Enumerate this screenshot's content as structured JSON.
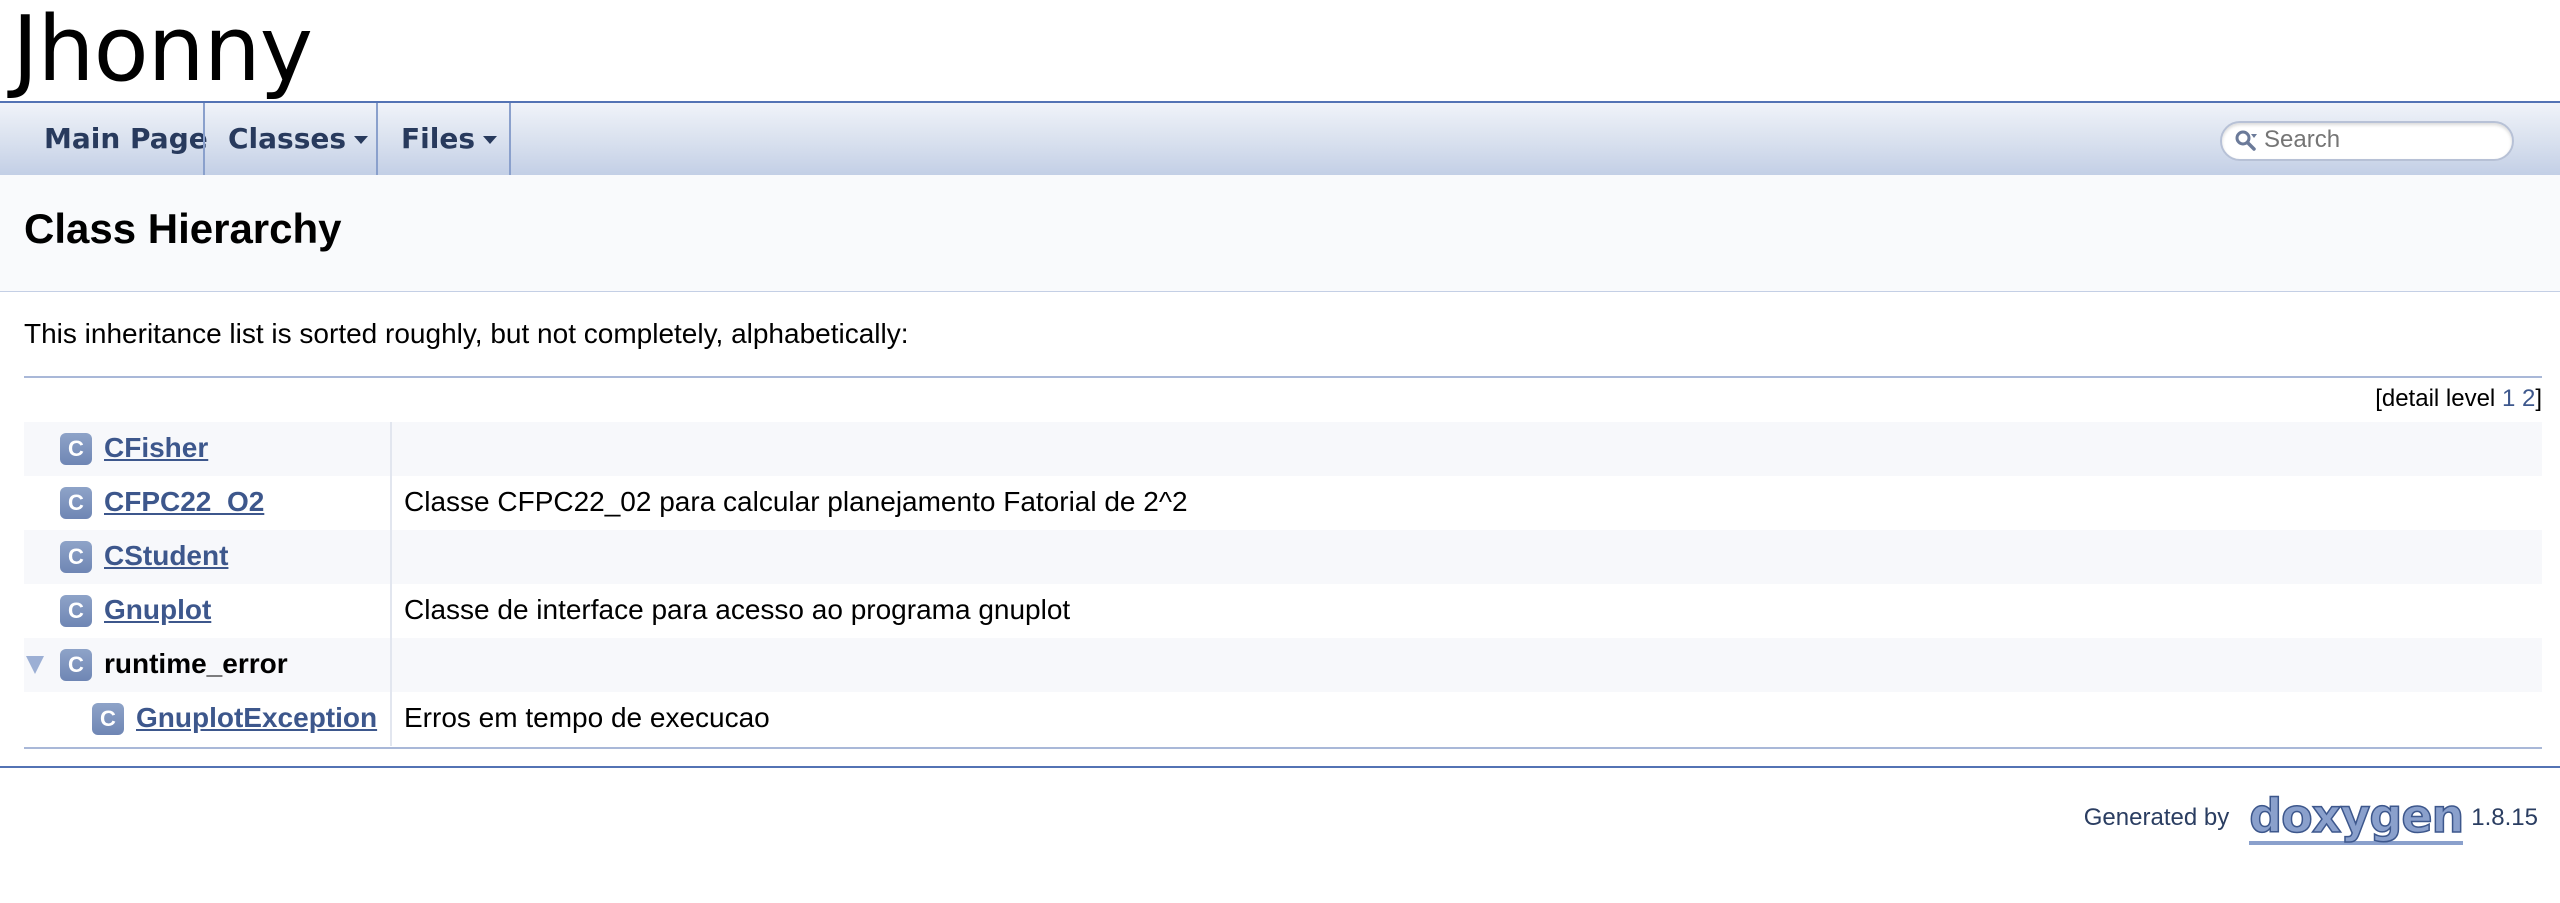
{
  "project": {
    "name": "Jhonny"
  },
  "nav": {
    "items": [
      {
        "label": "Main Page",
        "dropdown": false
      },
      {
        "label": "Classes",
        "dropdown": true
      },
      {
        "label": "Files",
        "dropdown": true
      }
    ],
    "search_placeholder": "Search"
  },
  "page": {
    "title": "Class Hierarchy",
    "intro": "This inheritance list is sorted roughly, but not completely, alphabetically:",
    "detail_level": {
      "prefix": "[detail level ",
      "levels": [
        "1",
        "2"
      ],
      "suffix": "]"
    }
  },
  "hierarchy": [
    {
      "icon": "C",
      "name": "CFisher",
      "desc": "",
      "level": 0,
      "link": true,
      "expanded": false
    },
    {
      "icon": "C",
      "name": "CFPC22_O2",
      "desc": "Classe CFPC22_02 para calcular planejamento Fatorial de 2^2",
      "level": 0,
      "link": true,
      "expanded": false
    },
    {
      "icon": "C",
      "name": "CStudent",
      "desc": "",
      "level": 0,
      "link": true,
      "expanded": false
    },
    {
      "icon": "C",
      "name": "Gnuplot",
      "desc": "Classe de interface para acesso ao programa gnuplot",
      "level": 0,
      "link": true,
      "expanded": false
    },
    {
      "icon": "C",
      "name": "runtime_error",
      "desc": "",
      "level": 0,
      "link": false,
      "expanded": true
    },
    {
      "icon": "C",
      "name": "GnuplotException",
      "desc": "Erros em tempo de execucao",
      "level": 1,
      "link": true,
      "expanded": false
    }
  ],
  "footer": {
    "generated_by": "Generated by",
    "logo_text": "doxygen",
    "version": "1.8.15"
  },
  "colors": {
    "accent": "#5373B4",
    "link": "#3d578c",
    "nav_text": "#283a5d"
  }
}
